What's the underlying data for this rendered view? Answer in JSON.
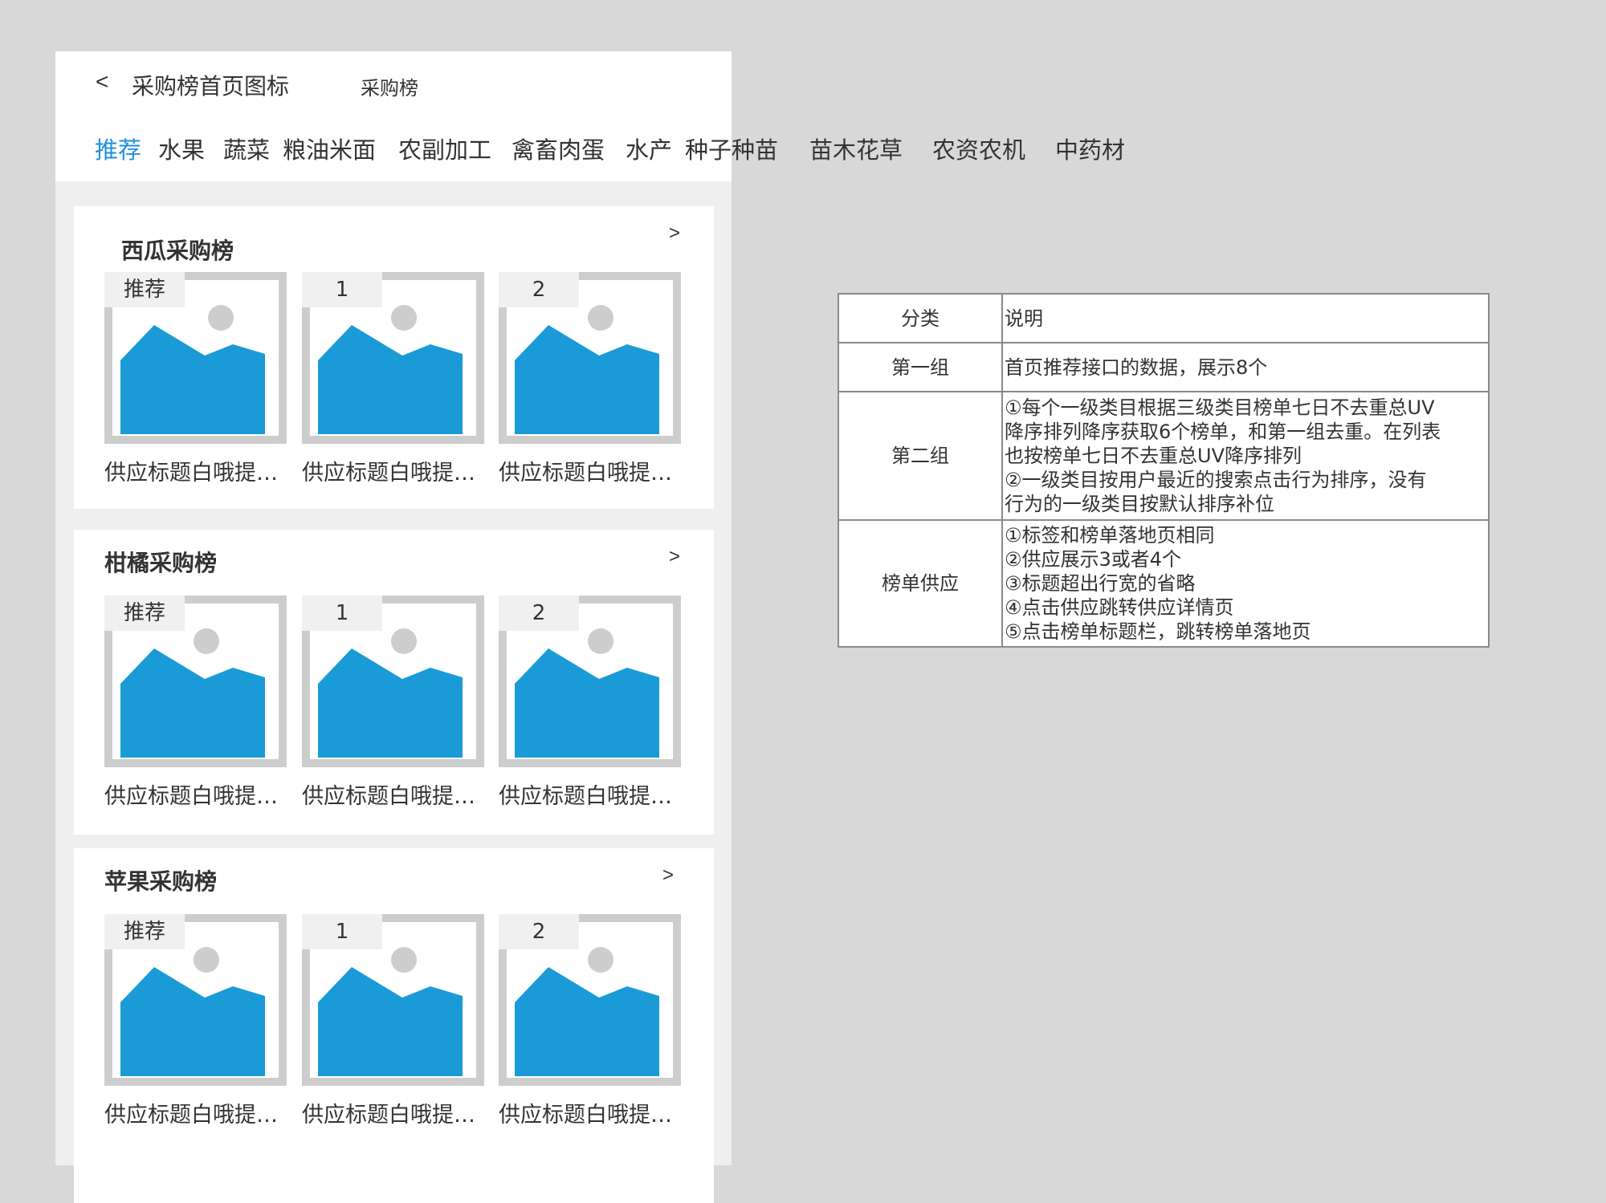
{
  "header": {
    "back_glyph": "<",
    "title": "采购榜首页图标",
    "subtitle": "采购榜"
  },
  "tabs": [
    "推荐",
    "水果",
    "蔬菜",
    "粮油米面",
    "农副加工",
    "禽畜肉蛋",
    "水产",
    "种子种苗",
    "苗木花草",
    "农资农机",
    "中药材"
  ],
  "active_tab_color": "#1e8fe0",
  "image_placeholder_color": "#1a9bd7",
  "cards": [
    {
      "title": "西瓜采购榜",
      "more": ">",
      "items": [
        {
          "badge": "推荐",
          "title": "供应标题白哦提…"
        },
        {
          "badge": "1",
          "title": "供应标题白哦提…"
        },
        {
          "badge": "2",
          "title": "供应标题白哦提…"
        }
      ]
    },
    {
      "title": "柑橘采购榜",
      "more": ">",
      "items": [
        {
          "badge": "推荐",
          "title": "供应标题白哦提…"
        },
        {
          "badge": "1",
          "title": "供应标题白哦提…"
        },
        {
          "badge": "2",
          "title": "供应标题白哦提…"
        }
      ]
    },
    {
      "title": "苹果采购榜",
      "more": ">",
      "items": [
        {
          "badge": "推荐",
          "title": "供应标题白哦提…"
        },
        {
          "badge": "1",
          "title": "供应标题白哦提…"
        },
        {
          "badge": "2",
          "title": "供应标题白哦提…"
        }
      ]
    }
  ],
  "table": {
    "header": {
      "category": "分类",
      "description": "说明"
    },
    "rows": [
      {
        "category": "第一组",
        "lines": [
          "首页推荐接口的数据，展示8个"
        ]
      },
      {
        "category": "第二组",
        "lines": [
          "①每个一级类目根据三级类目榜单七日不去重总UV",
          "降序排列降序获取6个榜单，和第一组去重。在列表",
          "也按榜单七日不去重总UV降序排列",
          "②一级类目按用户最近的搜索点击行为排序，没有",
          "行为的一级类目按默认排序补位"
        ]
      },
      {
        "category": "榜单供应",
        "lines": [
          "①标签和榜单落地页相同",
          "②供应展示3或者4个",
          "③标题超出行宽的省略",
          "④点击供应跳转供应详情页",
          "⑤点击榜单标题栏，跳转榜单落地页"
        ]
      }
    ]
  }
}
